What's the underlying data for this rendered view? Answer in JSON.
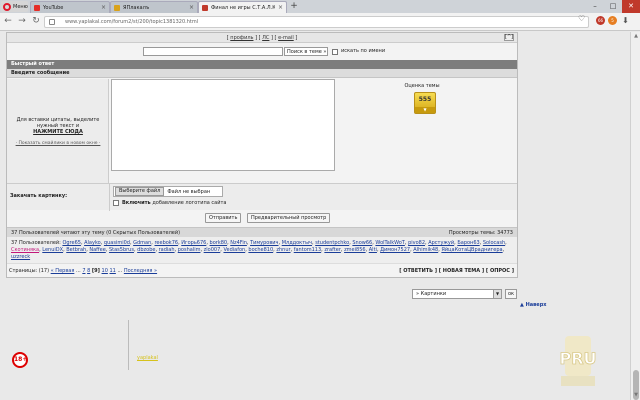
{
  "browser": {
    "opera_label": "Меню",
    "tabs": [
      {
        "label": "YouTube",
        "color": "#e52d27"
      },
      {
        "label": "ЯПлакалъ",
        "color": "#d9a21b"
      },
      {
        "label": "Финал не игры С.Т.А.Л.К.Е.Р.",
        "color": "#c0392b"
      }
    ],
    "new_tab": "+",
    "url": "www.yaplakal.com/forum2/st/200/topic1381320.html",
    "window_controls": [
      "–",
      "□",
      "✕"
    ],
    "ext_badges": [
      {
        "text": "66",
        "color": "#c0392b"
      },
      {
        "text": "5",
        "color": "#e67e22"
      }
    ]
  },
  "forum": {
    "top_links": {
      "open": "[",
      "profile": "профиль",
      "sep1": "] [",
      "pm": "ЛС",
      "sep2": "] [",
      "email": "e-mail",
      "close": "]"
    },
    "up_button": "[^]",
    "search": {
      "input_value": "",
      "select_value": "Поиск в теме »",
      "checkbox_label": "искать по имени"
    },
    "quick_reply": "Быстрый ответ",
    "enter_message": "Введите сообщение",
    "quote_hint_1": "Для вставки цитаты, выделите нужный текст и",
    "quote_hint_2": "НАЖМИТЕ СЮДА",
    "smiles_link": "· Показать смайлики в новом окне ·",
    "rating_title": "Оценка темы",
    "rating_value": "555",
    "rating_arrow": "▼",
    "attach_label": "Закачать картинку:",
    "file_button": "Выберите файл",
    "file_status": "Файл не выбран",
    "logo_checkbox_bold": "Включить",
    "logo_checkbox_rest": " добавление логотипа сайта",
    "send_button": "Отправить",
    "preview_button": "Предварительный просмотр",
    "readers_text": "37 Пользователей читают эту тему (0 Скрытых Пользователей)",
    "views_text": "Просмотры темы: 34773",
    "users_prefix": "37 Пользователей:",
    "users": [
      "Ogre65",
      "Alayko",
      "quasimi0d",
      "Gdman",
      "reebok76",
      "Игорь676",
      "bork80",
      "Nz4Fin",
      "Тимурович",
      "Млддоктыч",
      "studentpchko",
      "Snow66",
      "WolTalkWoT",
      "pivo82",
      "Арстужуй",
      "Барон63",
      "Solocash",
      "Скотиняка",
      "LenuiDX",
      "Betbrah",
      "Naffee",
      "Stas5brus",
      "dbzobe",
      "radiah",
      "poshalim",
      "zlo007",
      "Vediafon",
      "boche810",
      "zhnur",
      "fantom113",
      "zrafter",
      "zmei856",
      "Alti",
      "Димон7527",
      "Alhimik48",
      "ЯйцаКотаЦВраднигера",
      "uzzreck"
    ],
    "pager_prefix": "Страницы: (17)",
    "pager_first": "« Первая",
    "pager_dots": "...",
    "pager_pages": [
      "7",
      "8",
      "[9]",
      "10",
      "11"
    ],
    "pager_last": "Последняя »",
    "actions": "[ ОТВЕТИТЬ ] [ НОВАЯ ТЕМА ] [ ОПРОС ]"
  },
  "jump": {
    "select_value": "» Картинки",
    "ok": "ок",
    "to_top": "▲ Наверх"
  },
  "footer": {
    "age_rating": "18+",
    "link_text": "yaplakal"
  },
  "watermark_text": "PRU"
}
